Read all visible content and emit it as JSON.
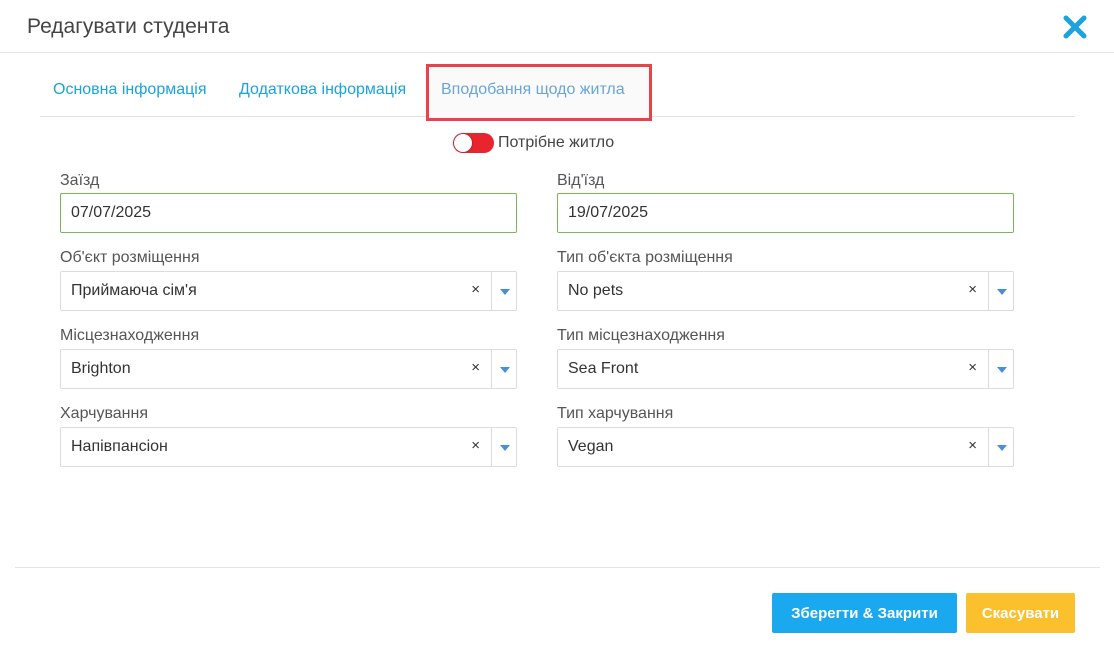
{
  "modal": {
    "title": "Редагувати студента",
    "close_icon": "close-icon",
    "accent_color": "#1aa3de"
  },
  "tabs": [
    {
      "label": "Основна інформація",
      "active": false
    },
    {
      "label": "Додаткова інформація",
      "active": false
    },
    {
      "label": "Вподобання щодо житла",
      "active": true
    }
  ],
  "toggle": {
    "label": "Потрібне житло",
    "on": false,
    "color": "#e8252e"
  },
  "fields": {
    "arrival": {
      "label": "Заїзд",
      "value": "07/07/2025"
    },
    "departure": {
      "label": "Від'їзд",
      "value": "19/07/2025"
    },
    "accommodation": {
      "label": "Об'єкт розміщення",
      "value": "Приймаюча сім'я"
    },
    "accommodation_type": {
      "label": "Тип об'єкта розміщення",
      "value": "No pets"
    },
    "location": {
      "label": "Місцезнаходження",
      "value": "Brighton"
    },
    "location_type": {
      "label": "Тип місцезнаходження",
      "value": "Sea Front"
    },
    "meals": {
      "label": "Харчування",
      "value": "Напівпансіон"
    },
    "meals_type": {
      "label": "Тип харчування",
      "value": "Vegan"
    }
  },
  "select_clear_symbol": "×",
  "buttons": {
    "save": "Зберегти & Закрити",
    "cancel": "Скасувати",
    "save_color": "#1aa9ee",
    "cancel_color": "#fbc02d"
  }
}
